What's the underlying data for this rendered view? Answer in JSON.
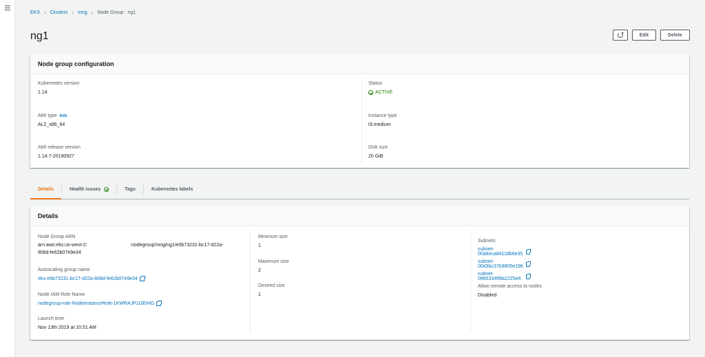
{
  "breadcrumb": {
    "items": [
      "EKS",
      "Clusters",
      "mng",
      "Node Group : ng1"
    ]
  },
  "page": {
    "title": "ng1"
  },
  "actions": {
    "edit_label": "Edit",
    "delete_label": "Delete"
  },
  "config": {
    "title": "Node group configuration",
    "kubernetes_version_label": "Kubernetes version",
    "kubernetes_version": "1.14",
    "ami_type_label": "AMI type",
    "ami_type_info": "Info",
    "ami_type": "AL2_x86_64",
    "ami_release_label": "AMI release version",
    "ami_release": "1.14.7-20190927",
    "status_label": "Status",
    "status": "ACTIVE",
    "instance_type_label": "Instance type",
    "instance_type": "t3.medium",
    "disk_size_label": "Disk size",
    "disk_size": "20 GiB"
  },
  "tabs": [
    "Details",
    "Health issues",
    "Tags",
    "Kubernetes labels"
  ],
  "details": {
    "title": "Details",
    "arn_label": "Node Group ARN",
    "arn_part1": "arn:aws:eks:us-west-2:",
    "arn_part2": ":nodegroup/mng/ng1/e0b73231-bc17-d22a-",
    "arn_part3": "808d-fe62b07e9e34",
    "asg_label": "Autoscaling group name",
    "asg_value": "eks-e0b73231-bc17-d22a-808d-fe62b07e9e34",
    "iam_label": "Node IAM Role Name",
    "iam_value": "nodegroup-role-NodeInstanceRole-1KWRAJP1GEIHG",
    "launch_label": "Launch time",
    "launch_value": "Nov 13th 2019 at 10:51 AM",
    "min_label": "Minimum size",
    "min_value": "1",
    "max_label": "Maximum size",
    "max_value": "2",
    "desired_label": "Desired size",
    "desired_value": "1",
    "subnets_label": "Subnets",
    "subnets": [
      "subnet-00a8eca84118b6e35",
      "subnet-00d3bc37b9805e196",
      "subnet-0965334f9fa2225e8"
    ],
    "remote_label": "Allow remote access to nodes",
    "remote_value": "Disabled"
  },
  "colors": {
    "link": "#0073bb",
    "active_tab": "#ec7211",
    "success": "#1d8102"
  }
}
